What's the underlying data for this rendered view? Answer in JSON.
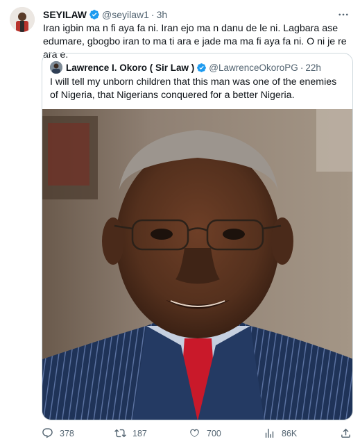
{
  "tweet": {
    "author_name": "SEYILAW",
    "author_handle": "@seyilaw1",
    "separator": "·",
    "time": "3h",
    "text": "Iran igbin ma n fi aya fa ni. Iran ejo ma n danu de le ni. Lagbara ase edumare, gbogbo iran to ma ti ara e jade ma ma fi aya fa ni. O ni je re ara e."
  },
  "quoted": {
    "author_name": "Lawrence I. Okoro ( Sir Law )",
    "author_handle": "@LawrenceOkoroPG",
    "separator": "·",
    "time": "22h",
    "text": "I will tell my unborn children that this man was one of the enemies of Nigeria, that Nigerians conquered for a better Nigeria."
  },
  "actions": {
    "replies": "378",
    "retweets": "187",
    "likes": "700",
    "views": "86K"
  },
  "colors": {
    "verified": "#1d9bf0",
    "muted": "#536471",
    "text": "#0f1419",
    "border": "#cfd9de"
  },
  "icons": [
    "more-icon",
    "verified-icon",
    "reply-icon",
    "retweet-icon",
    "like-icon",
    "views-icon",
    "share-icon"
  ]
}
